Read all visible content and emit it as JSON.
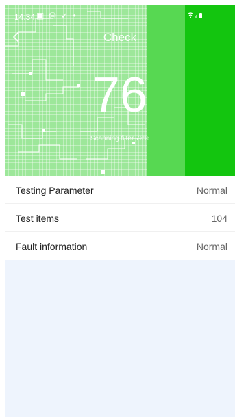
{
  "status_bar": {
    "time": "14:34",
    "left_icons": "▣ ⛁ ✓ •",
    "right_icons": "wifi signal battery"
  },
  "header": {
    "title": "Check",
    "back_icon": "chevron-left-icon"
  },
  "scan": {
    "score": "76",
    "status_text": "Scanning filter 76%",
    "progress_percent": 76
  },
  "colors": {
    "hero_bg": "#9de79a",
    "scan_band_light": "#57d852",
    "scan_band_dark": "#13c50f",
    "page_bg": "#eef4fd"
  },
  "items": [
    {
      "label": "Testing Parameter",
      "value": "Normal"
    },
    {
      "label": "Test items",
      "value": "104"
    },
    {
      "label": "Fault information",
      "value": "Normal"
    }
  ]
}
